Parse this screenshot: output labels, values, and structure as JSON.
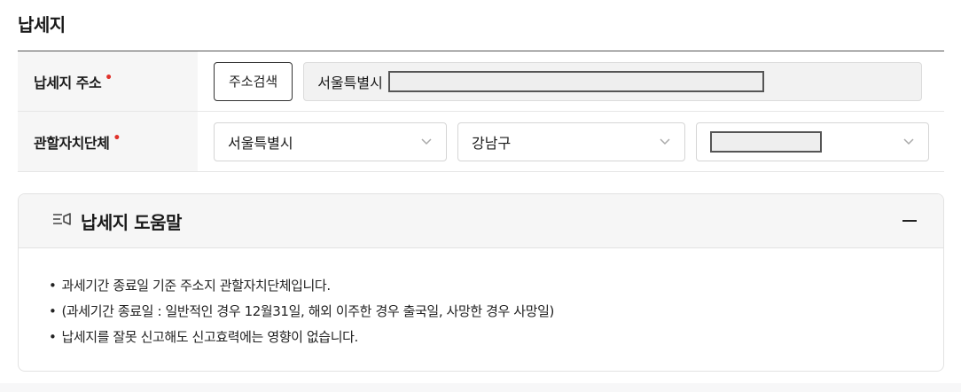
{
  "section": {
    "title": "납세지"
  },
  "address_row": {
    "label": "납세지 주소",
    "required_mark": "•",
    "search_button": "주소검색",
    "address_prefix": "서울특별시"
  },
  "district_row": {
    "label": "관할자치단체",
    "required_mark": "•",
    "city_select": {
      "selected": "서울특별시",
      "icon": "chevron-down-icon"
    },
    "district_select": {
      "selected": "강남구",
      "icon": "chevron-down-icon"
    },
    "dong_select": {
      "icon": "chevron-down-icon"
    }
  },
  "help": {
    "icon": "help-list-icon",
    "title": "납세지 도움말",
    "collapse_icon": "minus-icon",
    "items": [
      "과세기간 종료일 기준 주소지 관할자치단체입니다.",
      "(과세기간 종료일 : 일반적인 경우 12월31일, 해외 이주한 경우 출국일, 사망한 경우 사망일)",
      "납세지를 잘못 신고해도 신고효력에는 영향이 없습니다."
    ]
  }
}
